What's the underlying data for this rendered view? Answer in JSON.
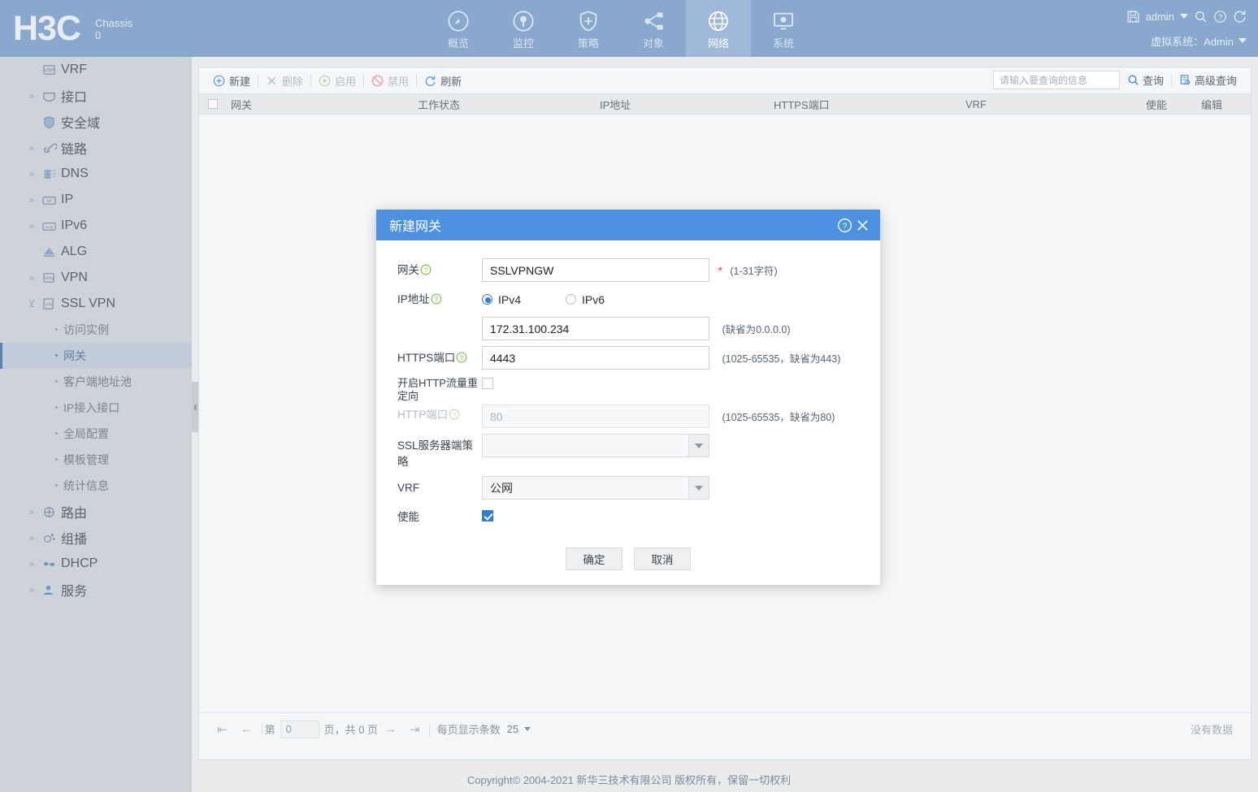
{
  "topbar": {
    "logo": "H3C",
    "chassis_label": "Chassis",
    "chassis_value": "0",
    "nav": [
      {
        "label": "概览",
        "icon": "gauge-icon",
        "active": false
      },
      {
        "label": "监控",
        "icon": "monitor-eye-icon",
        "active": false
      },
      {
        "label": "策略",
        "icon": "shield-plus-icon",
        "active": false
      },
      {
        "label": "对象",
        "icon": "share-nodes-icon",
        "active": false
      },
      {
        "label": "网络",
        "icon": "globe-icon",
        "active": true
      },
      {
        "label": "系统",
        "icon": "system-gear-icon",
        "active": false
      }
    ],
    "user": "admin",
    "save_icon": "save-icon",
    "search_icon": "search-icon",
    "help_icon": "help-circle-icon",
    "logout_icon": "logout-icon",
    "vsys_label": "虚拟系统：Admin"
  },
  "sidebar": {
    "items": [
      {
        "label": "VRF",
        "icon": "vrf-icon",
        "expandable": false,
        "level": 1
      },
      {
        "label": "接口",
        "icon": "interface-icon",
        "expandable": true,
        "level": 1
      },
      {
        "label": "安全域",
        "icon": "shield-icon",
        "expandable": false,
        "level": 1
      },
      {
        "label": "链路",
        "icon": "link-icon",
        "expandable": true,
        "level": 1
      },
      {
        "label": "DNS",
        "icon": "dns-icon",
        "expandable": true,
        "level": 1
      },
      {
        "label": "IP",
        "icon": "ip-icon",
        "expandable": true,
        "level": 1
      },
      {
        "label": "IPv6",
        "icon": "ipv6-icon",
        "expandable": true,
        "level": 1
      },
      {
        "label": "ALG",
        "icon": "alg-icon",
        "expandable": false,
        "level": 1
      },
      {
        "label": "VPN",
        "icon": "vpn-icon",
        "expandable": true,
        "level": 1
      },
      {
        "label": "SSL VPN",
        "icon": "sslvpn-icon",
        "expandable": true,
        "expanded": true,
        "level": 1
      }
    ],
    "sslvpn_children": [
      {
        "label": "访问实例",
        "selected": false
      },
      {
        "label": "网关",
        "selected": true
      },
      {
        "label": "客户端地址池",
        "selected": false
      },
      {
        "label": "IP接入接口",
        "selected": false
      },
      {
        "label": "全局配置",
        "selected": false
      },
      {
        "label": "模板管理",
        "selected": false
      },
      {
        "label": "统计信息",
        "selected": false
      }
    ],
    "items_after": [
      {
        "label": "路由",
        "icon": "route-icon",
        "expandable": true,
        "level": 1
      },
      {
        "label": "组播",
        "icon": "multicast-icon",
        "expandable": true,
        "level": 1
      },
      {
        "label": "DHCP",
        "icon": "dhcp-icon",
        "expandable": true,
        "level": 1
      },
      {
        "label": "服务",
        "icon": "service-icon",
        "expandable": true,
        "level": 1
      }
    ]
  },
  "toolbar": {
    "buttons": [
      {
        "label": "新建",
        "icon": "plus-circle-icon",
        "disabled": false
      },
      {
        "label": "删除",
        "icon": "x-icon",
        "disabled": true
      },
      {
        "label": "启用",
        "icon": "play-circle-icon",
        "disabled": true
      },
      {
        "label": "禁用",
        "icon": "ban-icon",
        "disabled": true
      },
      {
        "label": "刷新",
        "icon": "refresh-icon",
        "disabled": false
      }
    ],
    "search_placeholder": "请输入要查询的信息",
    "search_value": "",
    "search_label": "查询",
    "advanced_label": "高级查询",
    "search_icon": "search-icon",
    "advanced_icon": "advanced-search-icon"
  },
  "table": {
    "columns": [
      "网关",
      "工作状态",
      "IP地址",
      "HTTPS端口",
      "VRF",
      "使能",
      "编辑"
    ],
    "rows": [],
    "empty_text": "没有数据"
  },
  "pager": {
    "first_icon": "first-page-icon",
    "prev_icon": "prev-page-icon",
    "next_icon": "next-page-icon",
    "last_icon": "last-page-icon",
    "page_prefix": "第",
    "page_value": "0",
    "page_suffix": "页，共 0 页",
    "size_label": "每页显示条数",
    "size_value": "25"
  },
  "footer": {
    "copyright": "Copyright© 2004-2021 新华三技术有限公司 版权所有，保留一切权利"
  },
  "dialog": {
    "title": "新建网关",
    "help_icon": "help-circle-icon",
    "close_icon": "close-icon",
    "fields": {
      "gateway_label": "网关",
      "gateway_value": "SSLVPNGW",
      "gateway_hint": "(1-31字符)",
      "gateway_required": "*",
      "ip_label": "IP地址",
      "ipv4_label": "IPv4",
      "ipv6_label": "IPv6",
      "ip_selected": "IPv4",
      "ip_value": "172.31.100.234",
      "ip_hint": "(缺省为0.0.0.0)",
      "https_port_label": "HTTPS端口",
      "https_port_value": "4443",
      "https_port_hint": "(1025-65535，缺省为443)",
      "http_redirect_label": "开启HTTP流量重定向",
      "http_redirect_checked": false,
      "http_port_label": "HTTP端口",
      "http_port_placeholder": "80",
      "http_port_value": "",
      "http_port_hint": "(1025-65535，缺省为80)",
      "ssl_policy_label": "SSL服务器端策略",
      "ssl_policy_value": "",
      "vrf_label": "VRF",
      "vrf_value": "公网",
      "enable_label": "使能",
      "enable_checked": true
    },
    "ok_label": "确定",
    "cancel_label": "取消"
  },
  "colors": {
    "topbar": "#88a8cd",
    "sidebar": "#ced3d9",
    "dialog_header": "#4d92e0",
    "accent": "#2f7fd8",
    "required": "#e03b3b"
  }
}
